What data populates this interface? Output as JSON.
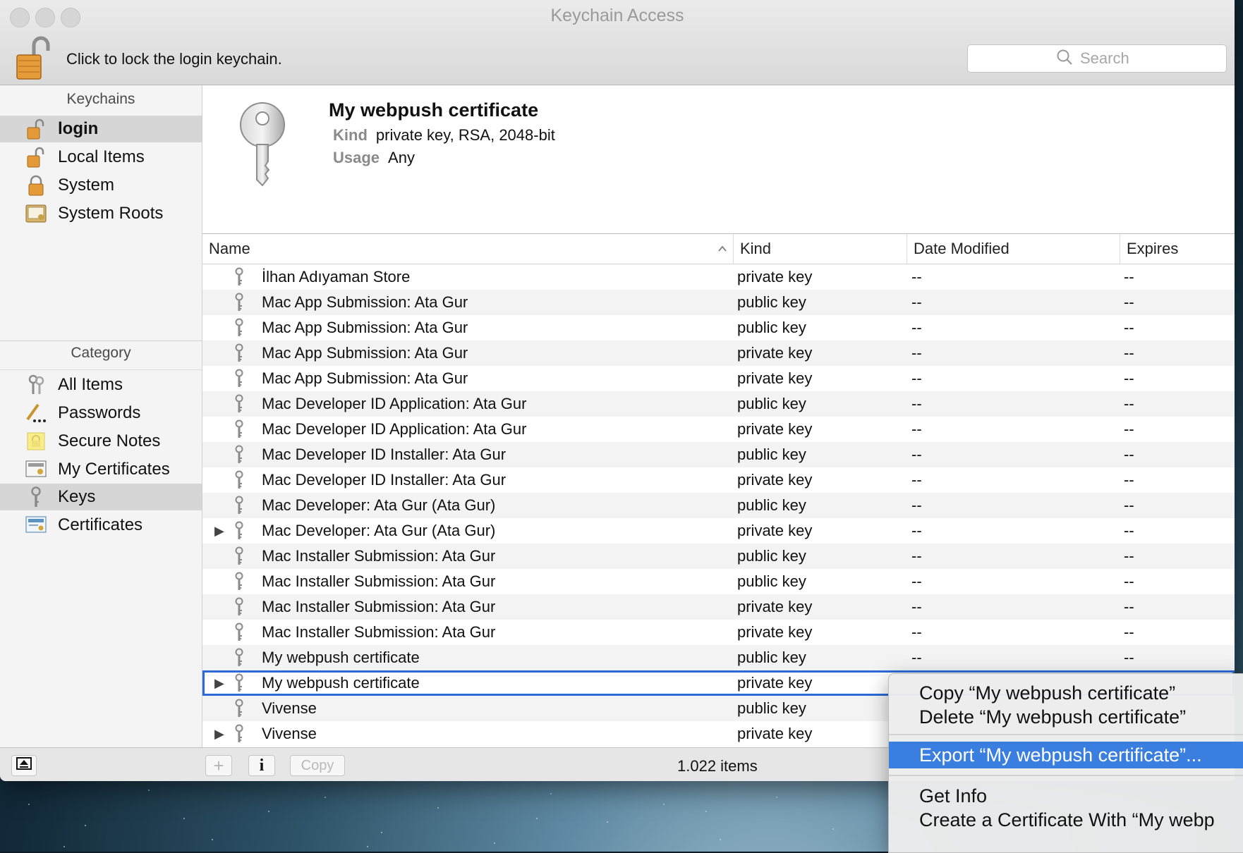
{
  "window": {
    "title": "Keychain Access",
    "lock_label": "Click to lock the login keychain.",
    "search_placeholder": "Search"
  },
  "sidebar": {
    "keychains_header": "Keychains",
    "keychains": [
      {
        "label": "login",
        "icon": "unlocked-padlock-icon",
        "selected": true
      },
      {
        "label": "Local Items",
        "icon": "unlocked-padlock-icon"
      },
      {
        "label": "System",
        "icon": "locked-padlock-icon"
      },
      {
        "label": "System Roots",
        "icon": "certificate-cabinet-icon"
      }
    ],
    "category_header": "Category",
    "categories": [
      {
        "label": "All Items",
        "icon": "keys-icon"
      },
      {
        "label": "Passwords",
        "icon": "pencil-dots-icon"
      },
      {
        "label": "Secure Notes",
        "icon": "note-icon"
      },
      {
        "label": "My Certificates",
        "icon": "my-certificate-icon"
      },
      {
        "label": "Keys",
        "icon": "key-icon",
        "selected": true
      },
      {
        "label": "Certificates",
        "icon": "certificate-icon"
      }
    ]
  },
  "detail": {
    "title": "My webpush certificate",
    "kind_label": "Kind",
    "kind_value": "private key, RSA, 2048-bit",
    "usage_label": "Usage",
    "usage_value": "Any"
  },
  "table": {
    "columns": [
      "Name",
      "Kind",
      "Date Modified",
      "Expires"
    ],
    "sort_indicator": "ascending",
    "rows": [
      {
        "name": "İlhan Adıyaman Store",
        "kind": "private key",
        "date": "--",
        "expires": "--"
      },
      {
        "name": "Mac App Submission: Ata Gur",
        "kind": "public key",
        "date": "--",
        "expires": "--"
      },
      {
        "name": "Mac App Submission: Ata Gur",
        "kind": "public key",
        "date": "--",
        "expires": "--"
      },
      {
        "name": "Mac App Submission: Ata Gur",
        "kind": "private key",
        "date": "--",
        "expires": "--"
      },
      {
        "name": "Mac App Submission: Ata Gur",
        "kind": "private key",
        "date": "--",
        "expires": "--"
      },
      {
        "name": "Mac Developer ID Application: Ata Gur",
        "kind": "public key",
        "date": "--",
        "expires": "--"
      },
      {
        "name": "Mac Developer ID Application: Ata Gur",
        "kind": "private key",
        "date": "--",
        "expires": "--"
      },
      {
        "name": "Mac Developer ID Installer: Ata Gur",
        "kind": "public key",
        "date": "--",
        "expires": "--"
      },
      {
        "name": "Mac Developer ID Installer: Ata Gur",
        "kind": "private key",
        "date": "--",
        "expires": "--"
      },
      {
        "name": "Mac Developer: Ata Gur (Ata Gur)",
        "kind": "public key",
        "date": "--",
        "expires": "--"
      },
      {
        "name": "Mac Developer: Ata Gur (Ata Gur)",
        "kind": "private key",
        "date": "--",
        "expires": "--",
        "expandable": true
      },
      {
        "name": "Mac Installer Submission: Ata Gur",
        "kind": "public key",
        "date": "--",
        "expires": "--"
      },
      {
        "name": "Mac Installer Submission: Ata Gur",
        "kind": "public key",
        "date": "--",
        "expires": "--"
      },
      {
        "name": "Mac Installer Submission: Ata Gur",
        "kind": "private key",
        "date": "--",
        "expires": "--"
      },
      {
        "name": "Mac Installer Submission: Ata Gur",
        "kind": "private key",
        "date": "--",
        "expires": "--"
      },
      {
        "name": "My webpush certificate",
        "kind": "public key",
        "date": "--",
        "expires": "--"
      },
      {
        "name": "My webpush certificate",
        "kind": "private key",
        "date": "",
        "expires": "",
        "expandable": true,
        "selected": true
      },
      {
        "name": "Vivense",
        "kind": "public key",
        "date": "",
        "expires": ""
      },
      {
        "name": "Vivense",
        "kind": "private key",
        "date": "",
        "expires": "",
        "expandable": true
      }
    ]
  },
  "statusbar": {
    "copy_label": "Copy",
    "info_label": "i",
    "items_count": "1.022 items"
  },
  "context_menu": {
    "items": [
      {
        "label": "Copy “My webpush certificate”"
      },
      {
        "label": "Delete “My webpush certificate”"
      },
      {
        "separator": true
      },
      {
        "label": "Export “My webpush certificate”...",
        "highlighted": true
      },
      {
        "separator": true
      },
      {
        "label": "Get Info"
      },
      {
        "label": "Create a Certificate With “My webp"
      }
    ]
  }
}
